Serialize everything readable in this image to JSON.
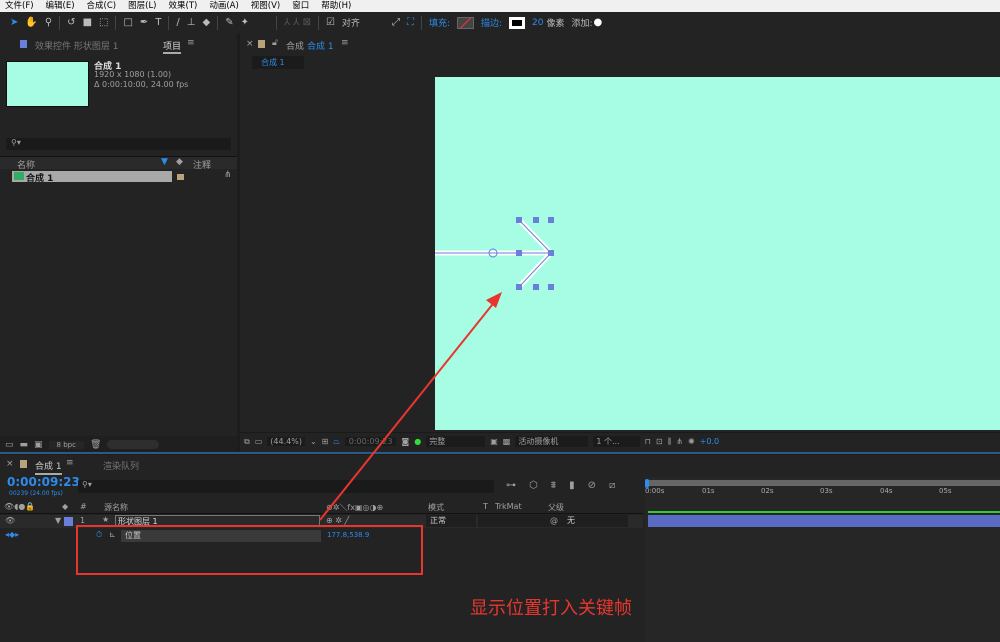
{
  "menu": [
    "文件(F)",
    "编辑(E)",
    "合成(C)",
    "图层(L)",
    "效果(T)",
    "动画(A)",
    "视图(V)",
    "窗口",
    "帮助(H)"
  ],
  "toolbar": {
    "align_label": "对齐",
    "fill_label": "填充:",
    "stroke_label": "描边:",
    "stroke_width": "20",
    "stroke_unit": "像素",
    "add_label": "添加:"
  },
  "project": {
    "tab_effects": "效果控件 形状图层 1",
    "tab_project": "项目",
    "comp_name": "合成 1",
    "resolution": "1920 x 1080 (1.00)",
    "duration": "Δ 0:00:10:00, 24.00 fps",
    "col_name": "名称",
    "col_comment": "注释",
    "items": [
      {
        "name": "合成 1"
      }
    ],
    "bpc": "8 bpc"
  },
  "viewer": {
    "tab_prefix": "合成",
    "tab_name": "合成 1",
    "subtab": "合成 1",
    "zoom": "(44.4%)",
    "timecode": "0:00:09:23",
    "quality": "完整",
    "camera": "活动摄像机",
    "views": "1 个...",
    "exposure": "+0.0",
    "canvas_color": "#a6fde4"
  },
  "timeline": {
    "tab_comp": "合成 1",
    "tab_render": "渲染队列",
    "timecode": "0:00:09:23",
    "frame_info": "00239 (24.00 fps)",
    "col_num": "#",
    "col_source": "源名称",
    "col_mode": "模式",
    "col_t": "T",
    "col_trkmat": "TrkMat",
    "col_parent": "父级",
    "layer": {
      "num": "1",
      "name": "形状图层 1",
      "mode": "正常",
      "parent": "无"
    },
    "property": {
      "name": "位置",
      "value": "177.8,538.9"
    },
    "ticks": [
      "0:00s",
      "01s",
      "02s",
      "03s",
      "04s",
      "05s"
    ]
  },
  "annotation": {
    "text": "显示位置打入关键帧",
    "color": "#e8362f"
  }
}
